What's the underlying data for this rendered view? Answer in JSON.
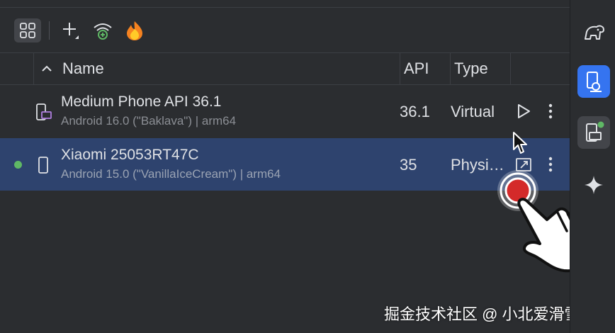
{
  "toolbar": {
    "icons": [
      "device-grid-icon",
      "add-device-icon",
      "pair-wifi-icon",
      "firebase-icon"
    ]
  },
  "table": {
    "columns": {
      "name": "Name",
      "api": "API",
      "type": "Type"
    },
    "sort_icon": "chevron-up-icon"
  },
  "devices": [
    {
      "name": "Medium Phone API 36.1",
      "subtitle": "Android 16.0 (\"Baklava\") | arm64",
      "api": "36.1",
      "type": "Virtual",
      "icon": "virtual-device-icon",
      "action_icon": "play-icon",
      "selected": false
    },
    {
      "name": "Xiaomi 25053RT47C",
      "subtitle": "Android 15.0 (\"VanillaIceCream\") | arm64",
      "api": "35",
      "type": "Physi…",
      "icon": "phone-icon",
      "action_icon": "mirror-screen-icon",
      "status": "online",
      "selected": true
    }
  ],
  "sidebar": {
    "icons": [
      "gradle-elephant-icon",
      "device-manager-icon",
      "running-devices-icon",
      "gemini-icon"
    ],
    "active": "device-manager-icon"
  },
  "overlay": {
    "watermark": "掘金技术社区 @ 小北爱滑雪",
    "colors": {
      "click_indicator": "#d42a2a",
      "selected_row": "#2e436e",
      "accent": "#3574f0",
      "online": "#5fb865"
    }
  }
}
